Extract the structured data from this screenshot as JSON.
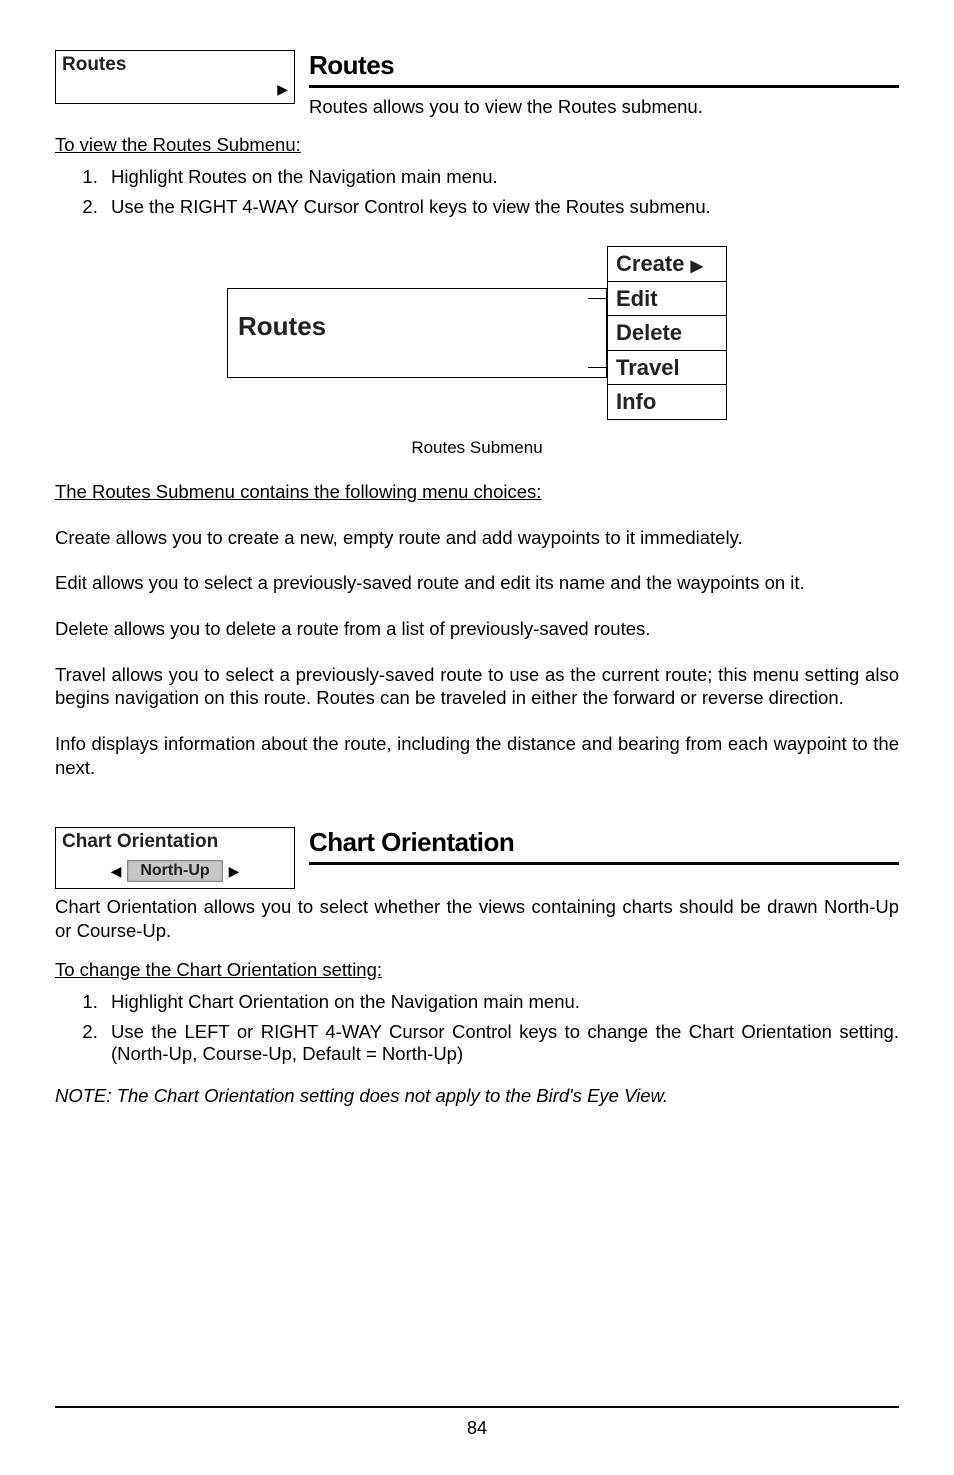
{
  "routes": {
    "menu_label": "Routes",
    "title": "Routes",
    "intro_prefix": "Routes",
    "intro_rest": " allows you to view the Routes submenu.",
    "steps_heading": "To view the Routes Submenu:",
    "steps": [
      "Highlight Routes on the Navigation main menu.",
      "Use the RIGHT 4-WAY Cursor Control keys to view the Routes submenu."
    ],
    "big_label": "Routes",
    "submenu": [
      "Create",
      "Edit",
      "Delete",
      "Travel",
      "Info"
    ],
    "fig_caption": "Routes Submenu",
    "choices_heading": "The Routes Submenu contains the following menu choices:",
    "create_b": "Create",
    "create_rest": " allows you to create a new, empty route and add waypoints to it immediately.",
    "edit_b": "Edit",
    "edit_rest": " allows you to select a previously-saved route and edit its name and the waypoints on it.",
    "delete_b": "Delete",
    "delete_rest": " allows you to delete a route from a list of previously-saved routes.",
    "travel_b": "Travel",
    "travel_rest": " allows you to select a previously-saved route to use as the current route; this menu setting also begins navigation on this route. Routes can be traveled in either the forward or reverse direction.",
    "info_b": "Info",
    "info_rest": " displays information about the route, including the distance and bearing from each waypoint to the next."
  },
  "chart": {
    "menu_label": "Chart Orientation",
    "value": "North-Up",
    "title": "Chart Orientation",
    "intro_b": "Chart Orientation",
    "intro_rest": " allows you to select whether the views containing charts should be drawn North-Up or Course-Up.",
    "steps_heading": "To change the Chart Orientation setting:",
    "steps": [
      "Highlight Chart Orientation on the Navigation main menu.",
      "Use the LEFT or RIGHT 4-WAY Cursor Control keys to change the Chart Orientation setting. (North-Up, Course-Up, Default = North-Up)"
    ],
    "note_b": "NOTE:",
    "note_rest": " The Chart Orientation setting does not apply to the Bird's Eye View."
  },
  "page_number": "84"
}
